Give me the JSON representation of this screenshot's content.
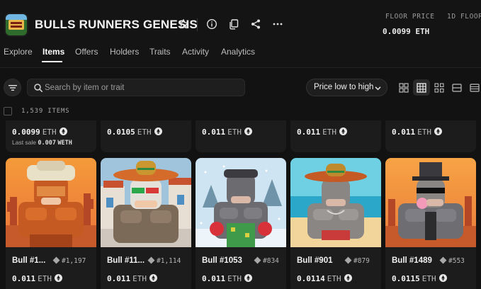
{
  "collection": {
    "name": "BULLS RUNNERS GENESIS",
    "logo_text": "BULLS RUNNERS"
  },
  "header_icons": [
    "star-icon",
    "info-icon",
    "copy-icon",
    "share-icon",
    "more-icon"
  ],
  "stats": [
    {
      "label": "FLOOR PRICE",
      "value": "0.0099 ETH"
    },
    {
      "label": "1D FLOOR",
      "value": ""
    }
  ],
  "tabs": [
    "Explore",
    "Items",
    "Offers",
    "Holders",
    "Traits",
    "Activity",
    "Analytics"
  ],
  "active_tab": "Items",
  "search": {
    "placeholder": "Search by item or trait",
    "value": ""
  },
  "sort": {
    "selected": "Price low to high"
  },
  "item_count": "1,539 ITEMS",
  "colors": {
    "background": "#121212",
    "card": "#1c1c1c",
    "accent": "#ffffff"
  },
  "top_row": [
    {
      "price": "0.0099",
      "unit": "ETH",
      "last_sale_label": "Last sale",
      "last_sale_value": "0.007",
      "last_sale_unit": "WETH"
    },
    {
      "price": "0.0105",
      "unit": "ETH"
    },
    {
      "price": "0.011",
      "unit": "ETH"
    },
    {
      "price": "0.011",
      "unit": "ETH"
    },
    {
      "price": "0.011",
      "unit": "ETH"
    }
  ],
  "items": [
    {
      "name": "Bull #1...",
      "rank": "#1,197",
      "price": "0.011",
      "unit": "ETH"
    },
    {
      "name": "Bull #11...",
      "rank": "#1,114",
      "price": "0.011",
      "unit": "ETH"
    },
    {
      "name": "Bull #1053",
      "rank": "#834",
      "price": "0.011",
      "unit": "ETH"
    },
    {
      "name": "Bull #901",
      "rank": "#879",
      "price": "0.0114",
      "unit": "ETH"
    },
    {
      "name": "Bull #1489",
      "rank": "#553",
      "price": "0.0115",
      "unit": "ETH"
    }
  ]
}
